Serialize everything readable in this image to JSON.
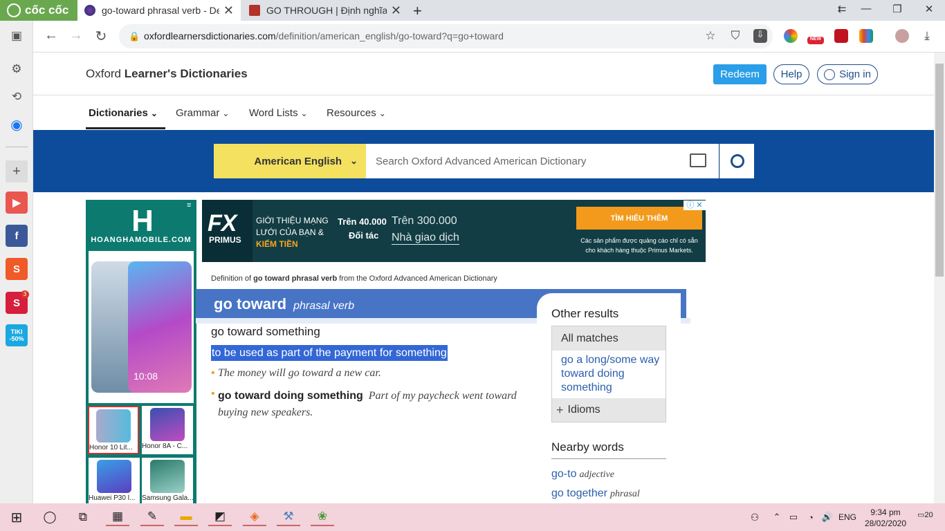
{
  "browser": {
    "brand": "cốc cốc",
    "tabs": [
      {
        "title": "go-toward phrasal verb - Def",
        "active": true
      },
      {
        "title": "GO THROUGH | Định nghĩa tr",
        "active": false
      }
    ],
    "new_tab": "+",
    "window_controls": {
      "minimize": "—",
      "restore": "❐",
      "close": "✕",
      "extra": "⇇"
    },
    "url_host": "oxfordlearnersdictionaries.com",
    "url_path": "/definition/american_english/go-toward?q=go+toward",
    "ext_badge": "NEW"
  },
  "sidebar": {
    "badge_count": "3",
    "tiki_label": "TIKI -50%"
  },
  "site": {
    "logo_prefix": "Oxford ",
    "logo_bold": "Learner's Dictionaries",
    "redeem": "Redeem",
    "help": "Help",
    "signin": "Sign in",
    "nav": [
      "Dictionaries",
      "Grammar",
      "Word Lists",
      "Resources"
    ],
    "dict_select": "American English",
    "search_placeholder": "Search Oxford Advanced American Dictionary"
  },
  "left_ad": {
    "logo": "H",
    "site": "HOANGHAMOBILE.COM",
    "menu": "≡",
    "phone_time": "10:08",
    "thumbs": [
      "Honor 10 Lit...",
      "Honor 8A - C...",
      "Huawei P30 l...",
      "Samsung Gala..."
    ]
  },
  "right_ad": {
    "brand": "FX",
    "brand2": "PRIMUS",
    "intro1": "GIỚI THIỆU MẠNG LƯỚI CỦA BẠN",
    "intro2": "& ",
    "intro_highlight": "KIẾM TIỀN",
    "n1": "Trên 40.000",
    "n2": "Trên 300.000",
    "l1": "Đối tác",
    "l2": "Nhà giao dịch",
    "cta": "TÌM HIỂU THÊM",
    "disclaimer": "Các sản phẩm được quảng cáo chỉ có sẵn cho khách hàng thuộc Primus Markets."
  },
  "entry": {
    "source_prefix": "Definition of ",
    "source_bold": "go toward phrasal verb",
    "source_suffix": " from the Oxford Advanced American Dictionary",
    "headword": "go toward",
    "pos": "phrasal verb",
    "sense_head": "go toward something",
    "definition": "to be used as part of the payment for something",
    "example1": "The money will go toward a new car.",
    "example2_bold": "go toward doing something",
    "example2": "Part of my paycheck went toward buying new speakers."
  },
  "other_results": {
    "title": "Other results",
    "all_matches": "All matches",
    "match_link": "go a long/some way toward doing something",
    "idioms": "Idioms",
    "idioms_icon": "+"
  },
  "nearby": {
    "title": "Nearby words",
    "items": [
      {
        "word": "go-to",
        "pos": "adjective"
      },
      {
        "word": "go together",
        "pos": "phrasal"
      }
    ]
  },
  "taskbar": {
    "time": "9:34 pm",
    "date": "28/02/2020",
    "lang": "ENG",
    "notif_count": "20"
  }
}
